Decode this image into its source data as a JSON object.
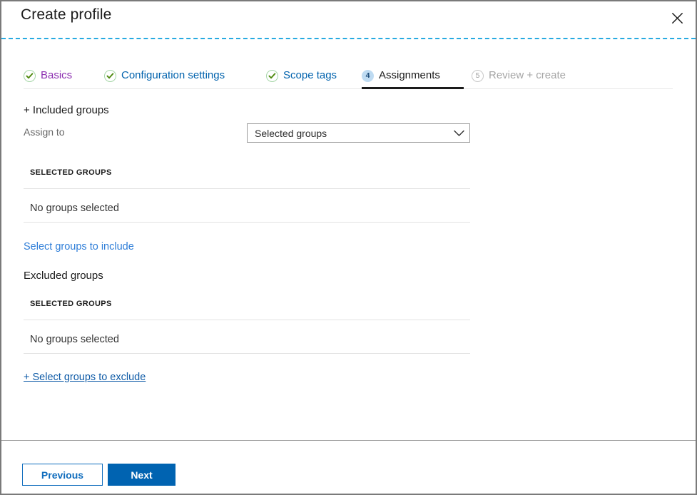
{
  "window": {
    "title": "Create profile",
    "close_icon": "close-icon",
    "accent_color": "#27aae1"
  },
  "wizard": {
    "tabs": [
      {
        "id": "basics",
        "label": "Basics",
        "state": "completed",
        "marker": "check-icon",
        "color": "#8c2eb0"
      },
      {
        "id": "configuration-settings",
        "label": "Configuration settings",
        "state": "completed",
        "marker": "check-icon",
        "color": "#0062ad"
      },
      {
        "id": "scope-tags",
        "label": "Scope tags",
        "state": "completed",
        "marker": "check-icon",
        "color": "#0062ad"
      },
      {
        "id": "assignments",
        "label": "Assignments",
        "state": "current",
        "marker": "4",
        "color": "#1b1b1b"
      },
      {
        "id": "review-create",
        "label": "Review + create",
        "state": "pending",
        "marker": "5",
        "color": "#a6a6a6"
      }
    ]
  },
  "form": {
    "included": {
      "heading": "+ Included groups",
      "assign_to_label": "Assign to",
      "assign_to_value": "Selected groups",
      "assign_to_chevron_icon": "chevron-down-icon",
      "column_header": "SELECTED GROUPS",
      "empty_text": "No groups selected",
      "action_link": "Select groups to include"
    },
    "excluded": {
      "heading": "Excluded groups",
      "column_header": "SELECTED GROUPS",
      "empty_text": "No groups selected",
      "action_link": "+ Select groups to exclude"
    }
  },
  "footer": {
    "previous_label": "Previous",
    "next_label": "Next",
    "primary_color": "#0063b1",
    "link_color": "#0f6cbd"
  }
}
